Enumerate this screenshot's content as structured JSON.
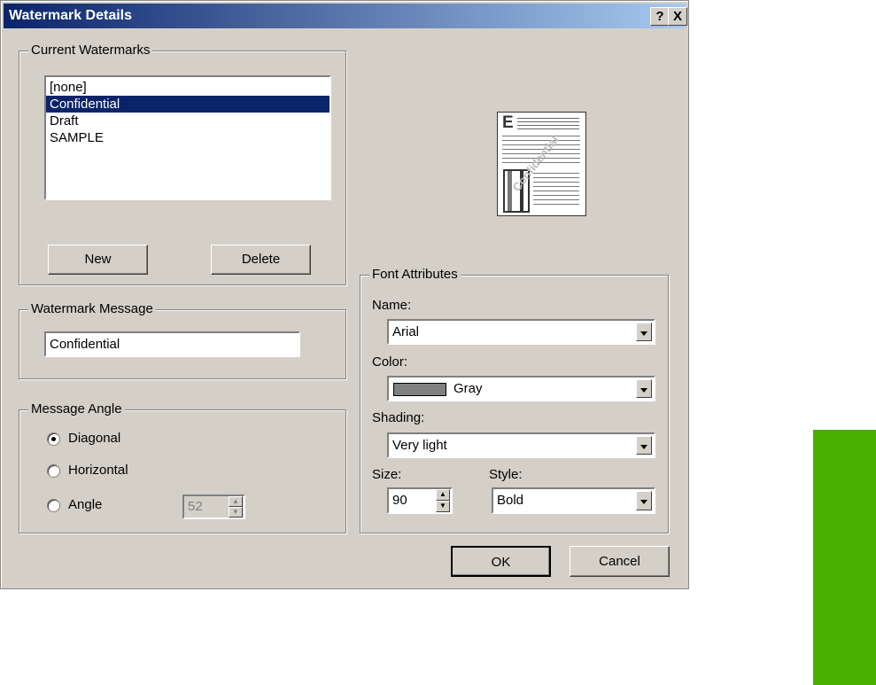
{
  "window": {
    "title": "Watermark Details",
    "help": "?",
    "close": "X"
  },
  "current": {
    "legend": "Current Watermarks",
    "items": [
      "[none]",
      "Confidential",
      "Draft",
      "SAMPLE"
    ],
    "selected": 1,
    "new_label": "New",
    "delete_label": "Delete"
  },
  "message": {
    "legend": "Watermark Message",
    "value": "Confidential"
  },
  "angle": {
    "legend": "Message Angle",
    "options": [
      "Diagonal",
      "Horizontal",
      "Angle"
    ],
    "selected": 0,
    "angle_value": "52"
  },
  "preview": {
    "watermark_text": "Confidential",
    "heading_letter": "E"
  },
  "font": {
    "legend": "Font Attributes",
    "name_label": "Name:",
    "name_value": "Arial",
    "color_label": "Color:",
    "color_value": "Gray",
    "color_swatch": "#808080",
    "shading_label": "Shading:",
    "shading_value": "Very light",
    "size_label": "Size:",
    "size_value": "90",
    "style_label": "Style:",
    "style_value": "Bold"
  },
  "buttons": {
    "ok": "OK",
    "cancel": "Cancel"
  },
  "accent": "#4aae00"
}
